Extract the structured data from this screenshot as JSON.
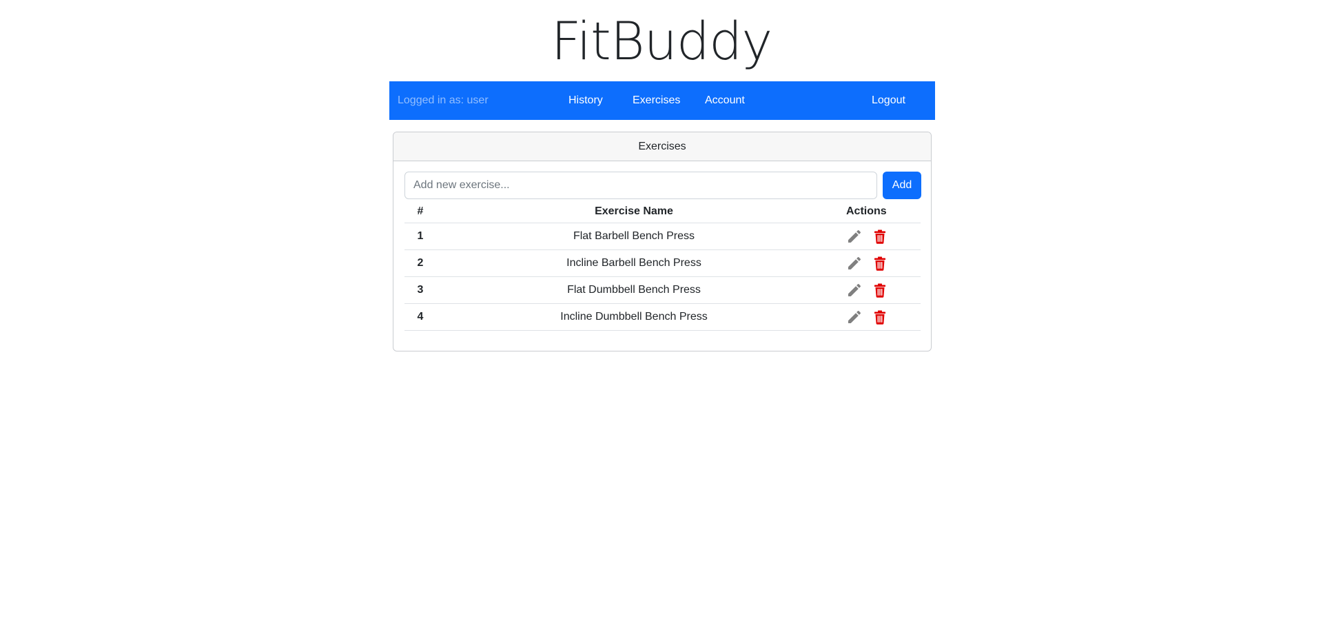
{
  "app": {
    "title": "FitBuddy"
  },
  "navbar": {
    "user_text": "Logged in as: user",
    "links": [
      {
        "label": "History"
      },
      {
        "label": "Exercises"
      },
      {
        "label": "Account"
      }
    ],
    "logout_label": "Logout",
    "color": "#0d6efd"
  },
  "card": {
    "header": "Exercises"
  },
  "add_form": {
    "placeholder": "Add new exercise...",
    "value": "",
    "button_label": "Add"
  },
  "table": {
    "headers": [
      "#",
      "Exercise Name",
      "Actions"
    ],
    "rows": [
      {
        "num": "1",
        "name": "Flat Barbell Bench Press"
      },
      {
        "num": "2",
        "name": "Incline Barbell Bench Press"
      },
      {
        "num": "3",
        "name": "Flat Dumbbell Bench Press"
      },
      {
        "num": "4",
        "name": "Incline Dumbbell Bench Press"
      }
    ],
    "row_actions": {
      "edit_icon": "pencil-icon",
      "edit_color": "#808080",
      "delete_icon": "trash-icon",
      "delete_color": "#e00000"
    }
  }
}
